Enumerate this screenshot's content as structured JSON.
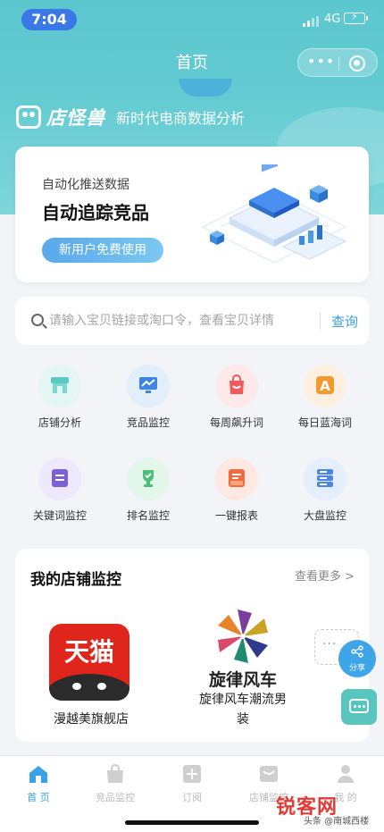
{
  "status_bar": {
    "time": "7:04",
    "network": "4G"
  },
  "nav": {
    "title": "首页",
    "more_icon": "•••"
  },
  "brand": {
    "name": "店怪兽",
    "slogan": "新时代电商数据分析"
  },
  "banner": {
    "subtitle": "自动化推送数据",
    "title": "自动追踪竞品",
    "button": "新用户免费使用"
  },
  "search": {
    "placeholder": "请输入宝贝链接或淘口令，查看宝贝详情",
    "button": "查询"
  },
  "tools": [
    {
      "label": "店铺分析",
      "icon": "store-icon",
      "color": "#5cc9c0",
      "bg": "#e3f6f4"
    },
    {
      "label": "竞品监控",
      "icon": "monitor-chart-icon",
      "color": "#3b86e0",
      "bg": "#e3eefb"
    },
    {
      "label": "每周飙升词",
      "icon": "shopping-bag-icon",
      "color": "#ef5a5a",
      "bg": "#fde9e9"
    },
    {
      "label": "每日蓝海词",
      "icon": "letter-a-icon",
      "color": "#f39a2c",
      "bg": "#fdf0e0"
    },
    {
      "label": "关键词监控",
      "icon": "book-icon",
      "color": "#7a5fd9",
      "bg": "#ede8fb"
    },
    {
      "label": "排名监控",
      "icon": "trophy-icon",
      "color": "#4cc07a",
      "bg": "#e3f6ea"
    },
    {
      "label": "一键报表",
      "icon": "report-icon",
      "color": "#f26a3d",
      "bg": "#fde9e1"
    },
    {
      "label": "大盘监控",
      "icon": "server-icon",
      "color": "#4a86e8",
      "bg": "#e5eefc"
    }
  ],
  "monitor": {
    "title": "我的店铺监控",
    "more": "查看更多 >",
    "stores": [
      {
        "name": "漫越美旗舰店",
        "logo_text": "天猫"
      },
      {
        "name_line1": "旋律风车潮流男",
        "name_line2": "装",
        "logo_text": "旋律风车"
      }
    ],
    "add_more": "···"
  },
  "fab": {
    "share_label": "分享"
  },
  "tabbar": [
    {
      "label": "首 页",
      "icon": "home-icon",
      "active": true
    },
    {
      "label": "竞品监控",
      "icon": "bag-icon",
      "active": false
    },
    {
      "label": "订阅",
      "icon": "subscribe-icon",
      "active": false
    },
    {
      "label": "店铺监控",
      "icon": "shop-monitor-icon",
      "active": false
    },
    {
      "label": "我 的",
      "icon": "user-icon",
      "active": false
    }
  ],
  "watermark": {
    "brand": "锐客网",
    "caption": "头条 @南城西楼"
  },
  "colors": {
    "accent": "#3aa2e6",
    "hero": "#5cc7cf",
    "tmall": "#e0251d"
  }
}
